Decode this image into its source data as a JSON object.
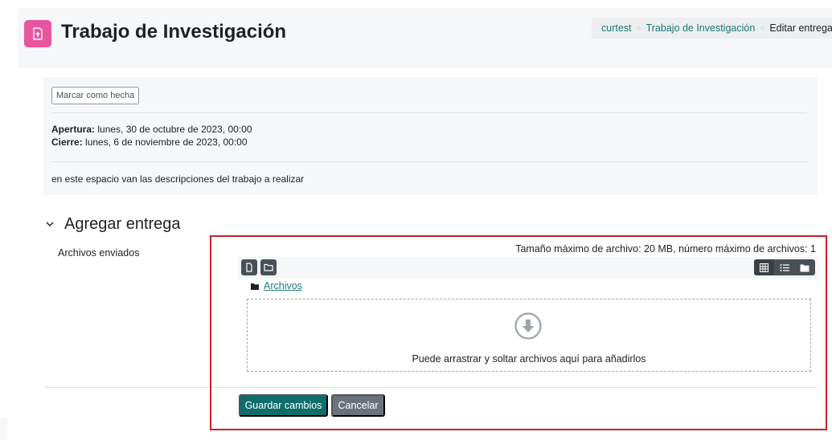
{
  "header": {
    "title": "Trabajo de Investigación",
    "icon": "assignment-upload-icon",
    "icon_color": "#e8559f"
  },
  "breadcrumb": {
    "items": [
      "curtest",
      "Trabajo de Investigación",
      "Editar entrega"
    ]
  },
  "activity": {
    "mark_done_label": "Marcar como hecha",
    "opening_label": "Apertura:",
    "opening_value": "lunes, 30 de octubre de 2023, 00:00",
    "closing_label": "Cierre:",
    "closing_value": "lunes, 6 de noviembre de 2023, 00:00",
    "description": "en este espacio van las descripciones del trabajo a realizar"
  },
  "section": {
    "toggle_icon": "chevron-down-icon",
    "title": "Agregar entrega"
  },
  "filemanager": {
    "field_label": "Archivos enviados",
    "max_info": "Tamaño máximo de archivo: 20 MB, número máximo de archivos: 1",
    "path_root": "Archivos",
    "drop_text": "Puede arrastrar y soltar archivos aquí para añadirlos"
  },
  "buttons": {
    "save": "Guardar cambios",
    "cancel": "Cancelar"
  },
  "colors": {
    "primary": "#0f6e6c",
    "secondary": "#6a737b",
    "link": "#1a7a78",
    "highlight": "#c9222c"
  }
}
